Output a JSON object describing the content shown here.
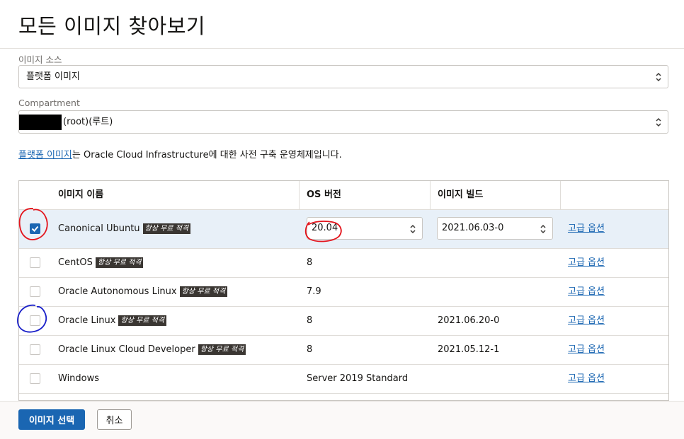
{
  "page": {
    "title": "모든 이미지 찾아보기"
  },
  "image_source": {
    "label": "이미지 소스",
    "value": "플랫폼 이미지"
  },
  "compartment": {
    "label": "Compartment",
    "value": "(root)(루트)"
  },
  "description": {
    "link": "플랫폼 이미지",
    "text": "는 Oracle Cloud Infrastructure에 대한 사전 구축 운영체제입니다."
  },
  "table": {
    "headers": [
      "이미지 이름",
      "OS 버전",
      "이미지 빌드"
    ],
    "badge_label": "항상 무료 적격",
    "advanced_link": "고급 옵션",
    "rows": [
      {
        "name": "Canonical Ubuntu",
        "badge": true,
        "os": "20.04",
        "build": "2021.06.03-0",
        "selected": true,
        "os_select": true,
        "build_select": true
      },
      {
        "name": "CentOS",
        "badge": true,
        "os": "8",
        "build": "",
        "selected": false
      },
      {
        "name": "Oracle Autonomous Linux",
        "badge": true,
        "os": "7.9",
        "build": "",
        "selected": false
      },
      {
        "name": "Oracle Linux",
        "badge": true,
        "os": "8",
        "build": "2021.06.20-0",
        "selected": false
      },
      {
        "name": "Oracle Linux Cloud Developer",
        "badge": true,
        "os": "8",
        "build": "2021.05.12-1",
        "selected": false
      },
      {
        "name": "Windows",
        "badge": false,
        "os": "Server 2019 Standard",
        "build": "",
        "selected": false
      }
    ]
  },
  "footer": {
    "select_label": "이미지 선택",
    "cancel_label": "취소"
  },
  "colors": {
    "accent": "#1a66b2",
    "selected_row": "#e8f0f8",
    "annotation_red": "#e3141c",
    "annotation_blue": "#1b21c9"
  },
  "icons": {
    "stepper": "up-down-chevron-icon",
    "check": "checkmark-icon"
  }
}
